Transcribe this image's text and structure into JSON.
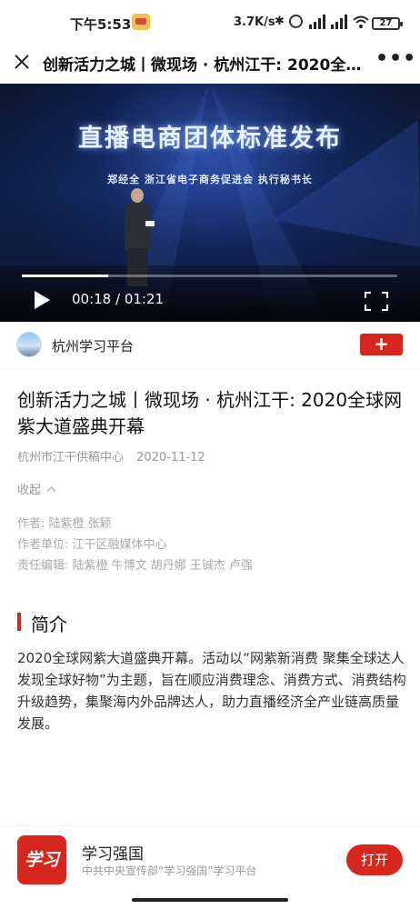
{
  "status_bar": {
    "time": "下午5:53",
    "network_speed": "3.7K/s",
    "battery": "27"
  },
  "header": {
    "title": "创新活力之城丨微现场 · 杭州江干: 2020全球网紫大道盛典开幕"
  },
  "video": {
    "headline": "直播电商团体标准发布",
    "subline": "郑经全  浙江省电子商务促进会 执行秘书长",
    "current_time": "00:18",
    "duration": "01:21",
    "time_display": "00:18 / 01:21",
    "progress_fraction": 0.23
  },
  "publisher": {
    "name": "杭州学习平台",
    "follow_label": "+"
  },
  "article": {
    "title": "创新活力之城丨微现场 · 杭州江干: 2020全球网紫大道盛典开幕",
    "source": "杭州市江干供稿中心",
    "date": "2020-11-12",
    "collapse_label": "收起",
    "author": "作者:  陆紫橙 张颖",
    "author_unit": "作者单位:  江干区融媒体中心",
    "editors": "责任编辑:  陆紫橙 牛博文 胡丹娜 王铖杰 卢强"
  },
  "intro": {
    "heading": "简介",
    "text": "2020全球网紫大道盛典开幕。活动以“网紫新消费 聚集全球达人 发现全球好物”为主题，旨在顺应消费理念、消费方式、消费结构升级趋势，集聚海内外品牌达人，助力直播经济全产业链高质量发展。"
  },
  "app_banner": {
    "logo_text": "学习",
    "name": "学习强国",
    "description": "中共中央宣传部“学习强国”学习平台",
    "open_label": "打开"
  },
  "colors": {
    "accent_red": "#d7261e",
    "muted_text": "#999999"
  }
}
